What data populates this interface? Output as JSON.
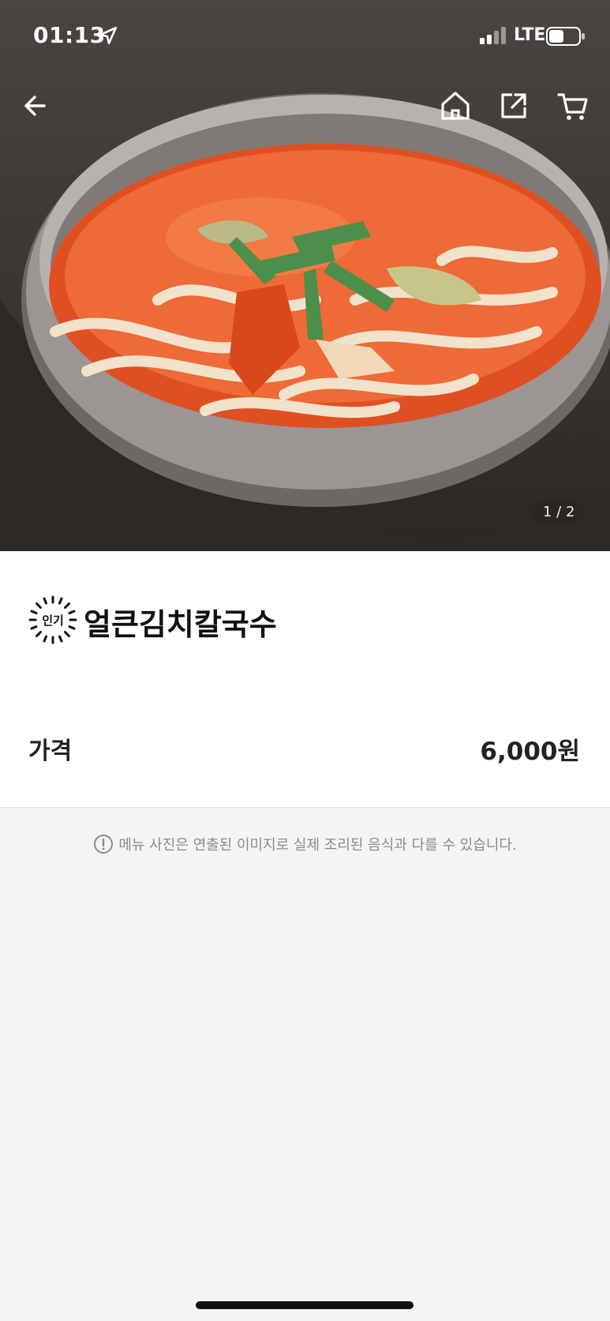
{
  "status_bar": {
    "time": "01:13",
    "network": "LTE",
    "icons": [
      "location-arrow-icon",
      "signal-icon",
      "battery-icon"
    ]
  },
  "top_nav": {
    "icons": [
      "back-arrow-icon",
      "home-icon",
      "share-icon",
      "cart-icon"
    ]
  },
  "gallery": {
    "pager": "1 / 2",
    "image_description": "kimchi kalguksu noodle soup in a metal bowl"
  },
  "menu": {
    "badge_text": "인기",
    "name": "얼큰김치칼국수"
  },
  "price": {
    "label": "가격",
    "value": "6,000원"
  },
  "notice": {
    "text": "메뉴 사진은 연출된 이미지로 실제 조리된 음식과 다를 수 있습니다.",
    "icon": "exclamation-circle-icon"
  },
  "colors": {
    "background": "#f4f4f4",
    "card": "#ffffff",
    "text": "#111111",
    "notice_text": "#8a8a8a"
  }
}
